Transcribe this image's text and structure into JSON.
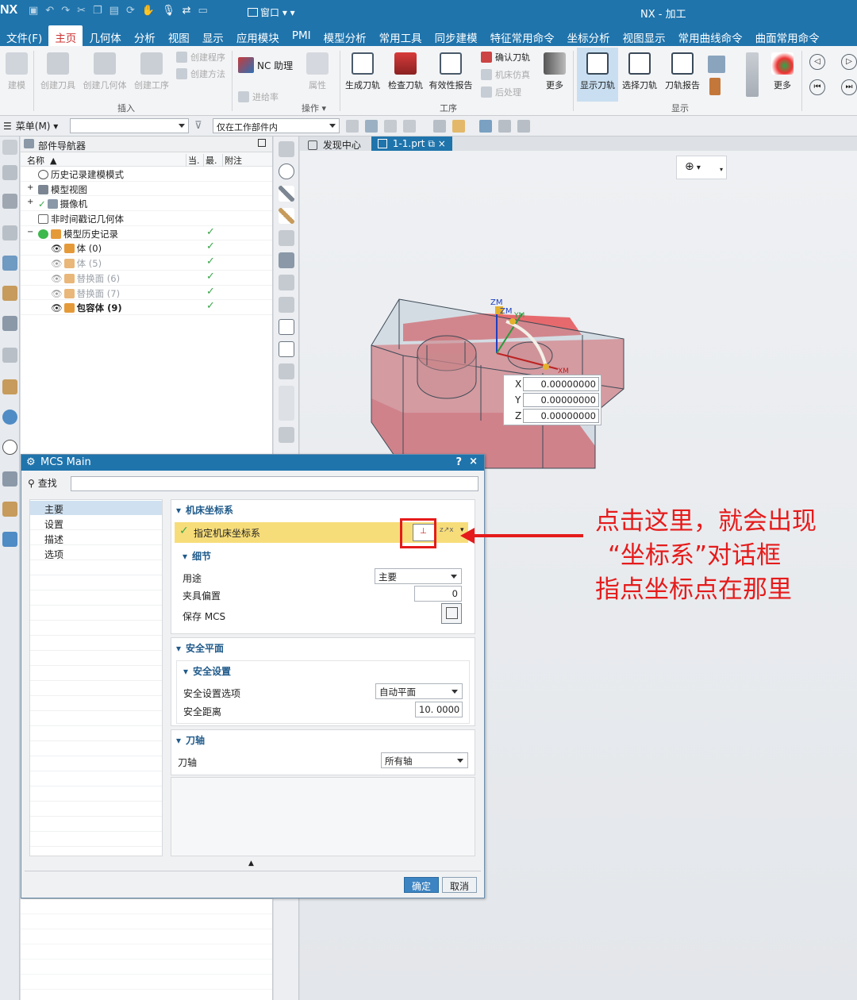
{
  "titlebar": {
    "logo": "NX",
    "window_menu": "窗口",
    "title": "NX - 加工"
  },
  "menubar": {
    "items": [
      "文件(F)",
      "主页",
      "几何体",
      "分析",
      "视图",
      "显示",
      "应用模块",
      "PMI",
      "模型分析",
      "常用工具",
      "同步建模",
      "特征常用命令",
      "坐标分析",
      "视图显示",
      "常用曲线命令",
      "曲面常用命令"
    ],
    "active_index": 1
  },
  "ribbon": {
    "buttons": {
      "build": "建模",
      "create_tool": "创建刀具",
      "create_geometry": "创建几何体",
      "create_operation": "创建工序",
      "create_program": "创建程序",
      "create_method": "创建方法",
      "nc_assistant": "NC 助理",
      "property": "属性",
      "feed_rate": "进给率",
      "generate_toolpath": "生成刀轨",
      "verify_toolpath": "检查刀轨",
      "validity_report": "有效性报告",
      "confirm_toolpath": "确认刀轨",
      "machine_simulation": "机床仿真",
      "post_process": "后处理",
      "more": "更多",
      "display_toolpath": "显示刀轨",
      "select_toolpath": "选择刀轨",
      "toolpath_report": "刀轨报告",
      "more2": "更多"
    },
    "groups": {
      "insert": "插入",
      "operation": "操作",
      "process": "工序",
      "display": "显示"
    }
  },
  "toolrow": {
    "menu_label": "菜单(M)",
    "filter_value": "",
    "scope_value": "仅在工作部件内"
  },
  "navigator": {
    "title": "部件导航器",
    "columns": {
      "name": "名称",
      "current": "当.",
      "latest": "最.",
      "note": "附注"
    },
    "rows": [
      {
        "label": "历史记录建模模式",
        "indent": 0,
        "check": false,
        "dim": false,
        "bold": false
      },
      {
        "label": "模型视图",
        "indent": 0,
        "check": false,
        "dim": false,
        "bold": false
      },
      {
        "label": "摄像机",
        "indent": 0,
        "check": false,
        "dim": false,
        "bold": false
      },
      {
        "label": "非时间戳记几何体",
        "indent": 0,
        "check": false,
        "dim": false,
        "bold": false
      },
      {
        "label": "模型历史记录",
        "indent": 0,
        "check": true,
        "dim": false,
        "bold": false
      },
      {
        "label": "体 (0)",
        "indent": 1,
        "check": true,
        "dim": false,
        "bold": false
      },
      {
        "label": "体 (5)",
        "indent": 1,
        "check": true,
        "dim": true,
        "bold": false
      },
      {
        "label": "替换面 (6)",
        "indent": 1,
        "check": true,
        "dim": true,
        "bold": false
      },
      {
        "label": "替换面 (7)",
        "indent": 1,
        "check": true,
        "dim": true,
        "bold": false
      },
      {
        "label": "包容体 (9)",
        "indent": 1,
        "check": true,
        "dim": false,
        "bold": true
      }
    ]
  },
  "tabs": {
    "discovery": "发现中心",
    "file": "1-1.prt"
  },
  "viewport": {
    "axis_labels": {
      "zm1": "ZM",
      "zm2": "ZM",
      "ym": "YM",
      "xm": "XM"
    },
    "coords": {
      "x": "0.00000000",
      "y": "0.00000000",
      "z": "0.00000000"
    },
    "coord_labels": {
      "x": "X",
      "y": "Y",
      "z": "Z"
    }
  },
  "dialog": {
    "title": "MCS Main",
    "help": "?",
    "close": "×",
    "search_label": "查找",
    "search_value": "",
    "tree": [
      "主要",
      "设置",
      "描述",
      "选项"
    ],
    "sections": {
      "machine_csys": "机床坐标系",
      "specify_mcs": "指定机床坐标系",
      "details": "细节",
      "purpose_label": "用途",
      "purpose_value": "主要",
      "fixture_offset_label": "夹具偏置",
      "fixture_offset_value": "0",
      "save_mcs_label": "保存 MCS",
      "clearance": "安全平面",
      "clearance_settings": "安全设置",
      "clearance_option_label": "安全设置选项",
      "clearance_option_value": "自动平面",
      "safe_distance_label": "安全距离",
      "safe_distance_value": "10. 0000",
      "tool_axis": "刀轴",
      "tool_axis_label": "刀轴",
      "tool_axis_value": "所有轴"
    },
    "ok": "确定",
    "cancel": "取消"
  },
  "annotation": {
    "lines": [
      "点击这里，就会出现",
      "“坐标系”对话框",
      "指点坐标点在那里"
    ],
    "color": "#e51b1b"
  },
  "colors": {
    "brand": "#1f74ac",
    "active_menu_text": "#cc3333",
    "highlight_row": "#f7dd7a",
    "model_red": "#e0474a",
    "check_green": "#3aa64a"
  }
}
